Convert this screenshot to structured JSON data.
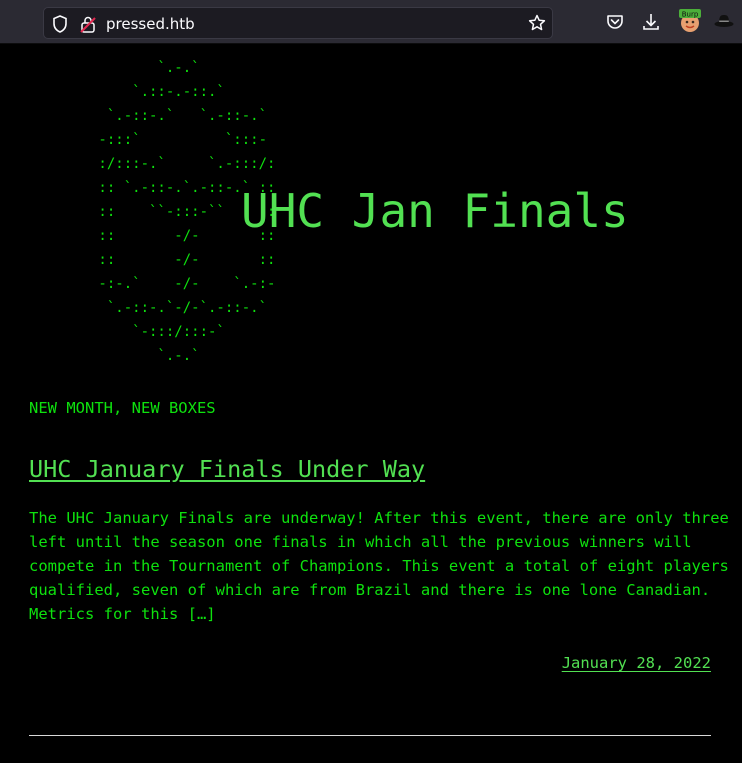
{
  "browser": {
    "url": "pressed.htb",
    "extension_badge": "Burp"
  },
  "site": {
    "ascii_art": "        `.-.`\n     `.::-.-::.`\n  `.-::-.`   `.-::-.`\n -:::`          `:::-\n :/:::-.`     `.-:::/:\n :: `.-::-.`.-::-.` ::\n ::    ``-:::-``    ::\n ::       -/-       ::\n ::       -/-       ::\n -:-.`    -/-    `.-:-\n  `.-::-.`-/-`.-::-.`\n     `-:::/:::-`\n        `.-.`",
    "title": "UHC Jan Finals",
    "tagline": "NEW MONTH, NEW BOXES"
  },
  "post": {
    "title": "UHC January Finals Under Way",
    "excerpt": "The UHC January Finals are underway! After this event, there are only three left until the season one finals in which all the previous winners will compete in the Tournament of Champions. This event a total of eight players qualified, seven of which are from Brazil and there is one lone Canadian. Metrics for this […]",
    "date": "January 28, 2022"
  },
  "colors": {
    "background": "#000000",
    "text_green": "#0ee10e",
    "title_green": "#52e052",
    "chrome_bg": "#2b2a33",
    "urlbar_bg": "#1c1b22"
  }
}
